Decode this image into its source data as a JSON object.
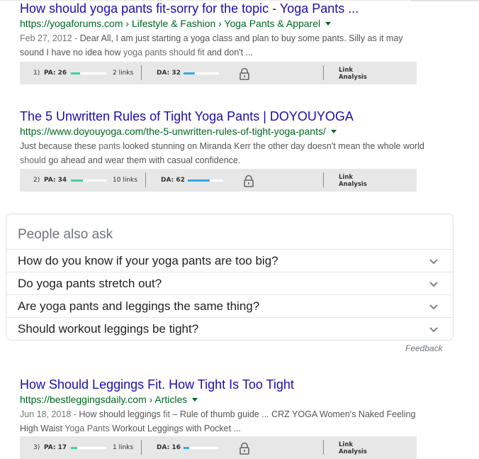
{
  "results": [
    {
      "title": "How should yoga pants fit-sorry for the topic - Yoga Pants ...",
      "url": "https://yogaforums.com › Lifestyle & Fashion › Yoga Pants & Apparel",
      "snippet_date": "Feb 27, 2012 - ",
      "snippet_line1": "Dear All, I am just starting a yoga class and plan to buy some pants. Silly as it may",
      "snippet_line2_a": "sound I have no idea how ",
      "snippet_line2_em": "yoga pants should fit",
      "snippet_line2_b": " and don't ...",
      "moz": {
        "num": "1)",
        "pa_label": "PA: 26",
        "pa": 26,
        "links": "2 links",
        "da_label": "DA: 32",
        "da": 32,
        "link_analysis": [
          "Link",
          "Analysis"
        ]
      }
    },
    {
      "title": "The 5 Unwritten Rules of Tight Yoga Pants | DOYOUYOGA",
      "url": "https://www.doyouyoga.com/the-5-unwritten-rules-of-tight-yoga-pants/",
      "snippet_line1_a": "Just because these ",
      "snippet_line1_em": "pants",
      "snippet_line1_b": " looked stunning on Miranda Kerr the other day doesn't mean the whole world",
      "snippet_line2_em": "should",
      "snippet_line2_b": " go ahead and wear them with casual confidence.",
      "moz": {
        "num": "2)",
        "pa_label": "PA: 34",
        "pa": 34,
        "links": "10 links",
        "da_label": "DA: 62",
        "da": 62,
        "link_analysis": [
          "Link",
          "Analysis"
        ]
      }
    },
    {
      "title": "How Should Leggings Fit. How Tight Is Too Tight",
      "url": "https://bestleggingsdaily.com › Articles",
      "snippet_date": "Jun 18, 2018 - ",
      "snippet_line1_a": "How should ",
      "snippet_line1_b": "leggings ",
      "snippet_line1_em": "fit",
      "snippet_line1_c": " – Rule of thumb guide ... CRZ YOGA Women's Naked Feeling",
      "snippet_line2_a": "High Waist ",
      "snippet_line2_em": "Yoga Pants",
      "snippet_line2_b": " Workout Leggings with Pocket ...",
      "moz": {
        "num": "3)",
        "pa_label": "PA: 17",
        "pa": 17,
        "links": "1 links",
        "da_label": "DA: 16",
        "da": 16,
        "link_analysis": [
          "Link",
          "Analysis"
        ]
      }
    }
  ],
  "people_also_ask": {
    "title": "People also ask",
    "questions": [
      "How do you know if your yoga pants are too big?",
      "Do yoga pants stretch out?",
      "Are yoga pants and leggings the same thing?",
      "Should workout leggings be tight?"
    ],
    "feedback": "Feedback"
  },
  "colors": {
    "pa_bar": "#3dd1a8",
    "da_bar": "#38a7e8",
    "title": "#1a0dab",
    "url": "#006621"
  },
  "icons": {
    "lock": "lock-icon",
    "chevron": "chevron-down-icon",
    "caret": "caret-down-icon"
  }
}
